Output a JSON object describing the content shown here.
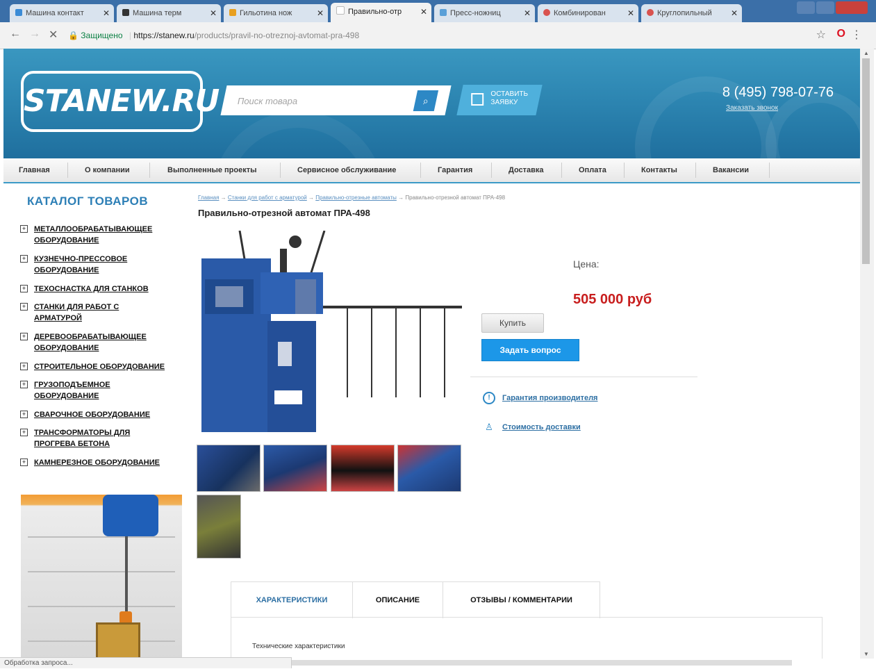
{
  "browser": {
    "tabs": [
      {
        "label": "Машина контакт",
        "fav": "#3a8bd6"
      },
      {
        "label": "Машина терм",
        "fav": "#333333"
      },
      {
        "label": "Гильотина нож",
        "fav": "#e8a020"
      },
      {
        "label": "Правильно-отр",
        "fav": "#ffffff",
        "active": true
      },
      {
        "label": "Пресс-ножниц",
        "fav": "#5aa0d8"
      },
      {
        "label": "Комбинирован",
        "fav": "#d9534f"
      },
      {
        "label": "Круглопильный",
        "fav": "#d9534f"
      }
    ],
    "secure_label": "Защищено",
    "url_host": "https://stanew.ru",
    "url_path": "/products/pravil-no-otreznoj-avtomat-pra-498"
  },
  "header": {
    "logo_text": "STANEW.RU",
    "search_placeholder": "Поиск товара",
    "order_label": "Оставить заявку",
    "phone": "8 (495) 798-07-76",
    "callback": "Заказать звонок"
  },
  "nav": [
    "Главная",
    "О компании",
    "Выполненные проекты",
    "Сервисное обслуживание",
    "Гарантия",
    "Доставка",
    "Оплата",
    "Контакты",
    "Вакансии"
  ],
  "catalog": {
    "title": "КАТАЛОГ ТОВАРОВ",
    "items": [
      "МЕТАЛЛООБРАБАТЫВАЮЩЕЕ ОБОРУДОВАНИЕ",
      "КУЗНЕЧНО-ПРЕССОВОЕ ОБОРУДОВАНИЕ",
      "ТЕХОСНАСТКА ДЛЯ СТАНКОВ",
      "СТАНКИ ДЛЯ РАБОТ С АРМАТУРОЙ",
      "ДЕРЕВООБРАБАТЫВАЮЩЕЕ ОБОРУДОВАНИЕ",
      "СТРОИТЕЛЬНОЕ ОБОРУДОВАНИЕ",
      "ГРУЗОПОДЪЕМНОЕ ОБОРУДОВАНИЕ",
      "СВАРОЧНОЕ ОБОРУДОВАНИЕ",
      "ТРАНСФОРМАТОРЫ ДЛЯ ПРОГРЕВА БЕТОНА",
      "КАМНЕРЕЗНОЕ ОБОРУДОВАНИЕ"
    ]
  },
  "product": {
    "breadcrumbs": [
      "Главная",
      "Станки для работ с арматурой",
      "Правильно-отрезные автоматы",
      "Правильно-отрезной автомат ПРА-498"
    ],
    "title": "Правильно-отрезной автомат ПРА-498",
    "price_label": "Цена:",
    "price": "505 000 руб",
    "buy_label": "Купить",
    "ask_label": "Задать вопрос",
    "warranty_label": "Гарантия производителя",
    "delivery_label": "Стоимость доставки",
    "tabs": [
      "ХАРАКТЕРИСТИКИ",
      "ОПИСАНИЕ",
      "ОТЗЫВЫ / КОММЕНТАРИИ"
    ],
    "specs_heading": "Технические характеристики"
  },
  "status_text": "Обработка запроса...",
  "colors": {
    "accent": "#2d88c5",
    "price": "#c81e1e",
    "ask_button": "#1c97e8"
  }
}
